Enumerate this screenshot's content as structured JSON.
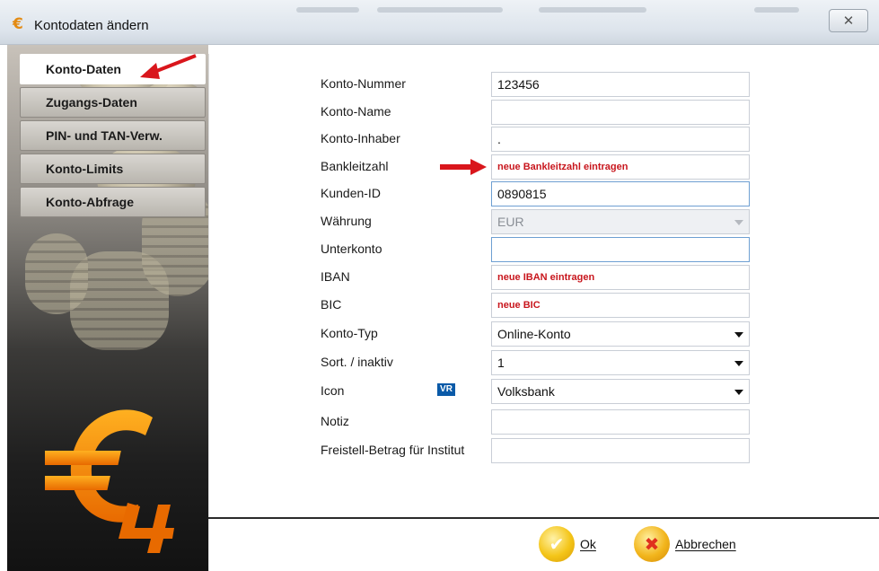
{
  "window": {
    "title": "Kontodaten ändern",
    "close_label": "✕"
  },
  "tabs": [
    {
      "label": "Konto-Daten",
      "active": true
    },
    {
      "label": "Zugangs-Daten",
      "active": false
    },
    {
      "label": "PIN- und TAN-Verw.",
      "active": false
    },
    {
      "label": "Konto-Limits",
      "active": false
    },
    {
      "label": "Konto-Abfrage",
      "active": false
    }
  ],
  "form": {
    "konto_nummer": {
      "label": "Konto-Nummer",
      "value": "123456"
    },
    "konto_name": {
      "label": "Konto-Name",
      "value": ""
    },
    "konto_inhaber": {
      "label": "Konto-Inhaber",
      "value": "."
    },
    "bankleitzahl": {
      "label": "Bankleitzahl",
      "value": "neue Bankleitzahl eintragen"
    },
    "kunden_id": {
      "label": "Kunden-ID",
      "value": "0890815"
    },
    "waehrung": {
      "label": "Währung",
      "value": "EUR"
    },
    "unterkonto": {
      "label": "Unterkonto",
      "value": ""
    },
    "iban": {
      "label": "IBAN",
      "value": "neue IBAN eintragen"
    },
    "bic": {
      "label": "BIC",
      "value": "neue BIC"
    },
    "konto_typ": {
      "label": "Konto-Typ",
      "value": "Online-Konto"
    },
    "sort_inaktiv": {
      "label": "Sort. / inaktiv",
      "value": "1"
    },
    "icon": {
      "label": "Icon",
      "value": "Volksbank",
      "badge": "VR"
    },
    "notiz": {
      "label": "Notiz",
      "value": ""
    },
    "freistell": {
      "label": "Freistell-Betrag für Institut",
      "value": ""
    }
  },
  "buttons": {
    "ok_label": "Ok",
    "cancel_label": "Abbrechen"
  },
  "icons": {
    "ok": "check-circle-icon",
    "cancel": "x-circle-icon",
    "volksbank": "volksbank-logo-icon"
  },
  "colors": {
    "annotation_red": "#d9161c",
    "euro_orange": "#f08a00",
    "ok_yellow": "#f4c518",
    "cancel_red": "#e0301e"
  }
}
